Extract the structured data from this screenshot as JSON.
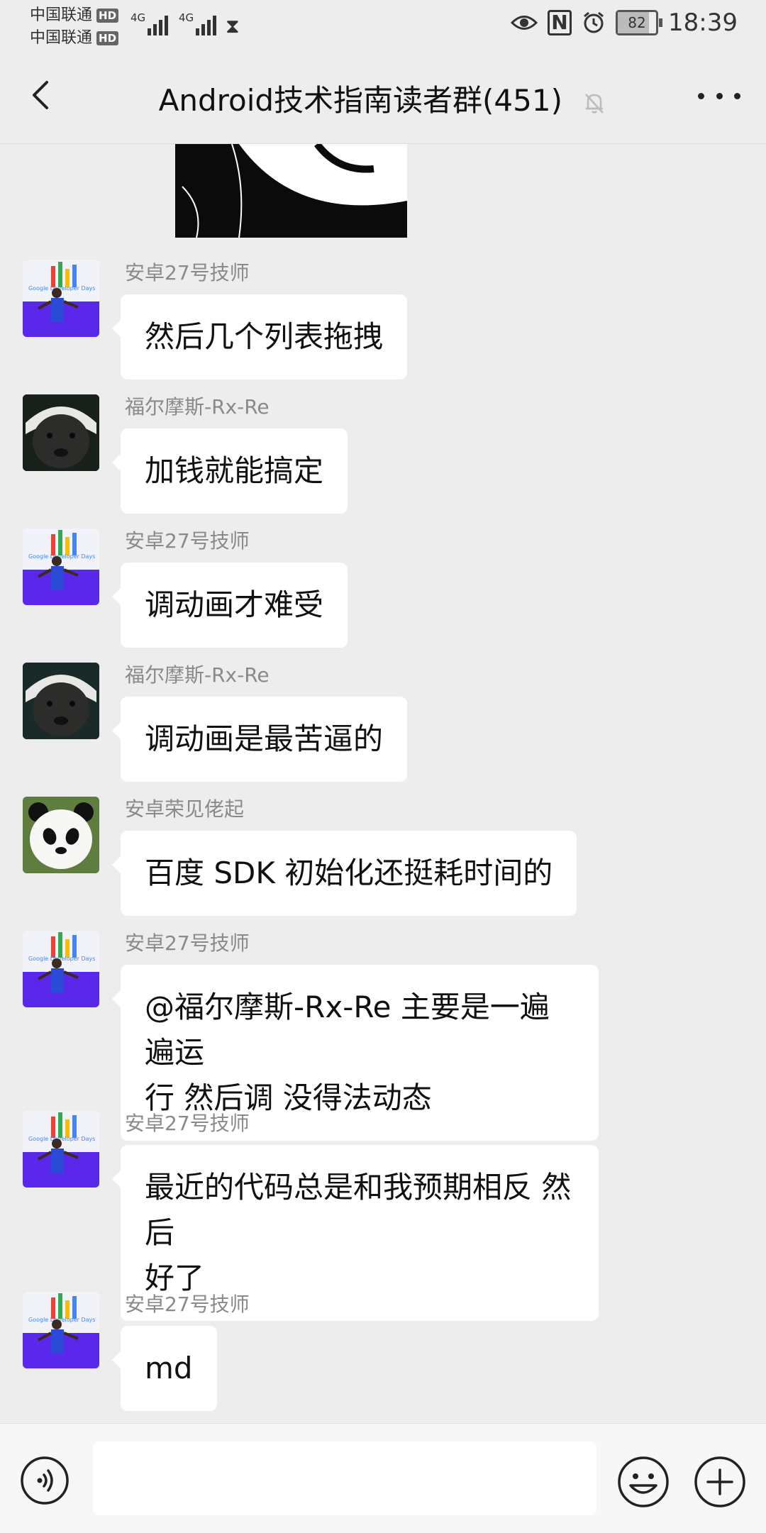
{
  "status_bar": {
    "carrier1": "中国联通",
    "carrier2": "中国联通",
    "hd_badge": "HD",
    "network1": "4G",
    "network2": "4G",
    "battery": "82",
    "battery_level": 0.82,
    "time": "18:39"
  },
  "header": {
    "title": "Android技术指南读者群(451)"
  },
  "messages": [
    {
      "sender": "安卓27号技师",
      "text": "然后几个列表拖拽",
      "avatar": "google-developer-days-avatar"
    },
    {
      "sender": "福尔摩斯-Rx-Re",
      "text": "加钱就能搞定",
      "avatar": "badger-avatar"
    },
    {
      "sender": "安卓27号技师",
      "text": "调动画才难受",
      "avatar": "google-developer-days-avatar"
    },
    {
      "sender": "福尔摩斯-Rx-Re",
      "text": "调动画是最苦逼的",
      "avatar": "badger-avatar"
    },
    {
      "sender": "安卓荣见佬起",
      "text": "百度 SDK 初始化还挺耗时间的",
      "avatar": "panda-avatar"
    },
    {
      "sender": "安卓27号技师",
      "line1": "@福尔摩斯-Rx-Re  主要是一遍遍运",
      "line2": "行 然后调 没得法动态",
      "avatar": "google-developer-days-avatar"
    },
    {
      "sender": "安卓27号技师",
      "line1": "最近的代码总是和我预期相反 然后",
      "line2": "好了",
      "avatar": "google-developer-days-avatar"
    },
    {
      "sender": "安卓27号技师",
      "text": "md",
      "avatar": "google-developer-days-avatar"
    }
  ],
  "input": {
    "value": ""
  },
  "colors": {
    "background": "#ededed",
    "bubble": "#ffffff",
    "sender_name": "#8a8a8a",
    "input_bar": "#f7f7f7"
  }
}
